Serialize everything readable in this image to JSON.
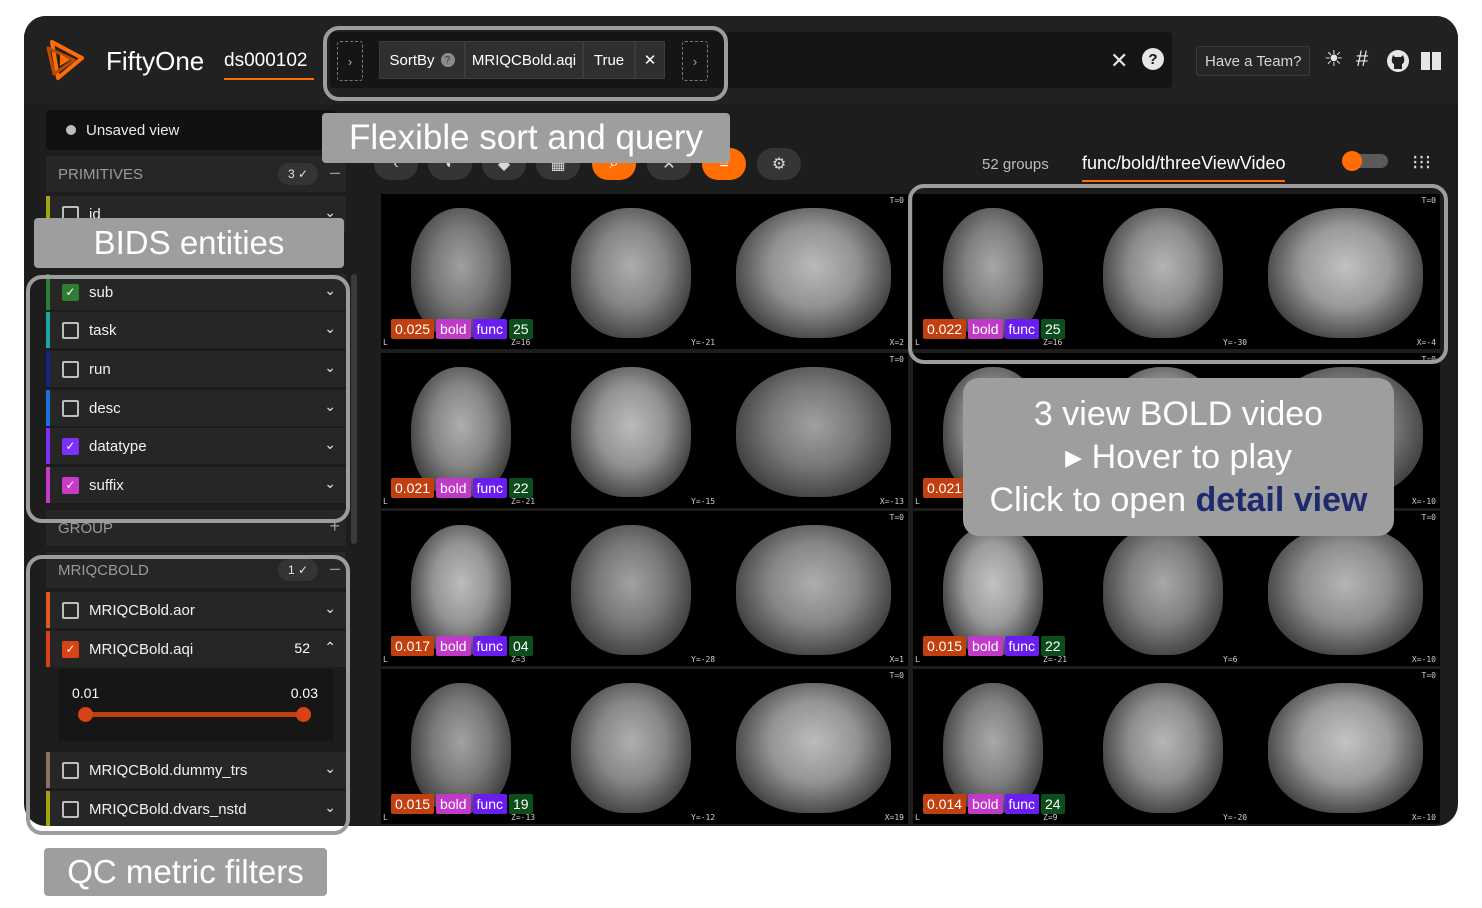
{
  "topbar": {
    "brand": "FiftyOne",
    "dataset": "ds000102",
    "sort_label": "SortBy",
    "sort_field": "MRIQCBold.aqi",
    "sort_reverse": "True",
    "team_label": "Have a Team?",
    "icons": [
      "logo-icon",
      "help-icon",
      "close-icon",
      "sun-icon",
      "slack-icon",
      "github-icon",
      "book-icon"
    ]
  },
  "sidebar": {
    "view_label": "Unsaved view",
    "primitives": {
      "title": "PRIMITIVES",
      "count": "3 ✓"
    },
    "partial_item": "id",
    "items": [
      {
        "label": "sub",
        "checked": true,
        "color": "#2e7d32"
      },
      {
        "label": "task",
        "checked": false,
        "color": "#1fa5a5"
      },
      {
        "label": "run",
        "checked": false,
        "color": "#1a237e"
      },
      {
        "label": "desc",
        "checked": false,
        "color": "#1e6fe0"
      },
      {
        "label": "datatype",
        "checked": true,
        "color": "#7b2ff7"
      },
      {
        "label": "suffix",
        "checked": true,
        "color": "#c83ac8"
      }
    ],
    "group_title": "GROUP",
    "mriqc": {
      "title": "MRIQCBOLD",
      "count": "1 ✓"
    },
    "mriqc_items": [
      {
        "label": "MRIQCBold.aor",
        "color": "#e05a1a"
      },
      {
        "label": "MRIQCBold.aqi",
        "count": "52",
        "color": "#d84315"
      },
      {
        "label": "MRIQCBold.dummy_trs",
        "color": "#8d6e63"
      },
      {
        "label": "MRIQCBold.dvars_nstd",
        "color": "#a4a410"
      }
    ],
    "range": {
      "min": "0.01",
      "max": "0.03",
      "low": 0.0,
      "high": 1.0
    }
  },
  "grid": {
    "group_count": "52 groups",
    "slice": "func/bold/threeViewVideo",
    "tiles": [
      {
        "aqi": "0.025",
        "suffix": "bold",
        "datatype": "func",
        "sub": "25",
        "z": "Z=16",
        "y": "Y=-21",
        "x": "X=2"
      },
      {
        "aqi": "0.022",
        "suffix": "bold",
        "datatype": "func",
        "sub": "25",
        "z": "Z=16",
        "y": "Y=-30",
        "x": "X=-4"
      },
      {
        "aqi": "0.021",
        "suffix": "bold",
        "datatype": "func",
        "sub": "22",
        "z": "Z=-21",
        "y": "Y=-15",
        "x": "X=-13"
      },
      {
        "aqi": "0.021",
        "suffix": "",
        "datatype": "",
        "sub": "",
        "z": "",
        "y": "",
        "x": "X=-10"
      },
      {
        "aqi": "0.017",
        "suffix": "bold",
        "datatype": "func",
        "sub": "04",
        "z": "Z=3",
        "y": "Y=-28",
        "x": "X=1"
      },
      {
        "aqi": "0.015",
        "suffix": "bold",
        "datatype": "func",
        "sub": "22",
        "z": "Z=-21",
        "y": "Y=6",
        "x": "X=-10"
      },
      {
        "aqi": "0.015",
        "suffix": "bold",
        "datatype": "func",
        "sub": "19",
        "z": "Z=-13",
        "y": "Y=-12",
        "x": "X=19"
      },
      {
        "aqi": "0.014",
        "suffix": "bold",
        "datatype": "func",
        "sub": "24",
        "z": "Z=9",
        "y": "Y=-20",
        "x": "X=-10"
      }
    ],
    "frame_label": "T=0",
    "side_label": "L"
  },
  "colors": {
    "accent": "#ff6d04",
    "aqi_badge": "#c0400f",
    "suffix_badge": "#c03ac8",
    "datatype_badge": "#6a1df0",
    "sub_badge": "#0d4d1c"
  },
  "annotations": {
    "sort": "Flexible sort and query",
    "bids": "BIDS entities",
    "video_line1": "3 view BOLD video",
    "video_line2": "▸ Hover to play",
    "video_line3a": "Click to open ",
    "video_line3b": "detail view",
    "qc": "QC metric filters"
  }
}
